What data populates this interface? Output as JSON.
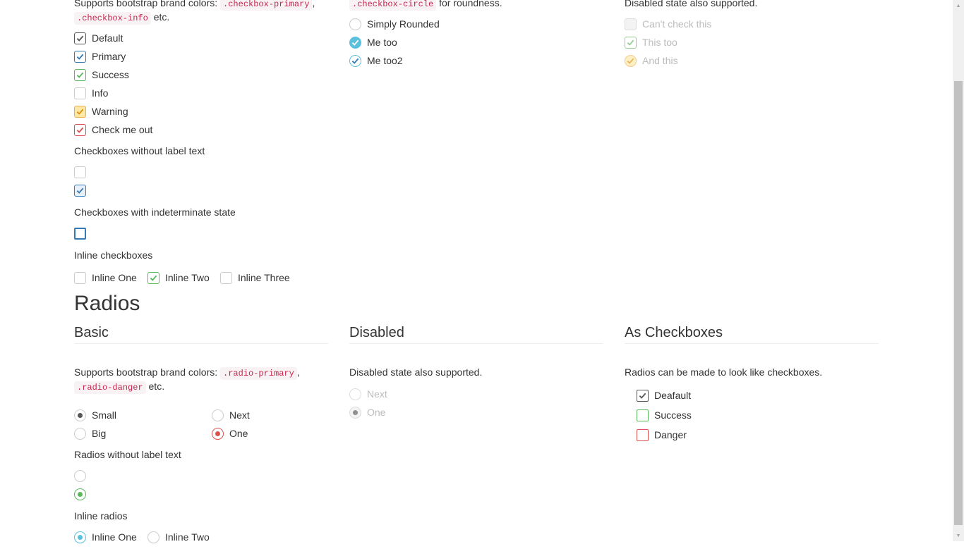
{
  "checkboxes": {
    "basic": {
      "intro_before": "Supports bootstrap brand colors:",
      "code1": ".checkbox-primary",
      "comma": ",",
      "code2": ".checkbox-info",
      "intro_after": "etc.",
      "options": [
        {
          "label": "Default",
          "checked": true,
          "color": "#555555"
        },
        {
          "label": "Primary",
          "checked": true,
          "color": "#337ab7"
        },
        {
          "label": "Success",
          "checked": true,
          "color": "#5cb85c"
        },
        {
          "label": "Info",
          "checked": false,
          "color": "#5bc0de"
        },
        {
          "label": "Warning",
          "checked": true,
          "color": "#f0ad4e"
        },
        {
          "label": "Check me out",
          "checked": true,
          "color": "#d9534f"
        }
      ],
      "no_label_heading": "Checkboxes without label text",
      "indeterminate_heading": "Checkboxes with indeterminate state",
      "inline_heading": "Inline checkboxes",
      "inline": [
        {
          "label": "Inline One",
          "checked": false
        },
        {
          "label": "Inline Two",
          "checked": true,
          "color": "#5cb85c"
        },
        {
          "label": "Inline Three",
          "checked": false
        }
      ]
    },
    "circle": {
      "code": ".checkbox-circle",
      "intro_after": "for roundness.",
      "options": [
        {
          "label": "Simply Rounded",
          "checked": false
        },
        {
          "label": "Me too",
          "checked": true,
          "color": "#5bc0de"
        },
        {
          "label": "Me too2",
          "checked": true,
          "color": "#5bc0de"
        }
      ]
    },
    "disabled": {
      "intro": "Disabled state also supported.",
      "options": [
        {
          "label": "Can't check this",
          "checked": false
        },
        {
          "label": "This too",
          "checked": true,
          "color": "#5cb85c"
        },
        {
          "label": "And this",
          "checked": true,
          "color": "#f0ad4e"
        }
      ]
    }
  },
  "radios": {
    "title": "Radios",
    "basic": {
      "heading": "Basic",
      "intro_before": "Supports bootstrap brand colors:",
      "code1": ".radio-primary",
      "comma": ",",
      "code2": ".radio-danger",
      "intro_after": "etc.",
      "options": [
        {
          "label": "Small",
          "checked": true,
          "color": "#555555"
        },
        {
          "label": "Big",
          "checked": false
        },
        {
          "label": "Next",
          "checked": false
        },
        {
          "label": "One",
          "checked": true,
          "color": "#d9534f"
        }
      ],
      "no_label_heading": "Radios without label text",
      "inline_heading": "Inline radios",
      "inline": [
        {
          "label": "Inline One",
          "checked": true,
          "color": "#5bc0de"
        },
        {
          "label": "Inline Two",
          "checked": false
        }
      ]
    },
    "disabled": {
      "heading": "Disabled",
      "intro": "Disabled state also supported.",
      "options": [
        {
          "label": "Next",
          "checked": false
        },
        {
          "label": "One",
          "checked": true,
          "color": "#555555"
        }
      ]
    },
    "as_checkboxes": {
      "heading": "As Checkboxes",
      "intro": "Radios can be made to look like checkboxes.",
      "options": [
        {
          "label": "Deafault",
          "checked": true,
          "color": "#555555"
        },
        {
          "label": "Success",
          "checked": false,
          "color": "#5cb85c"
        },
        {
          "label": "Danger",
          "checked": false,
          "color": "#d9534f"
        }
      ]
    }
  },
  "icons": {
    "check": "check-icon",
    "scroll_up": "scroll-up-arrow-icon",
    "scroll_down": "scroll-down-arrow-icon"
  }
}
